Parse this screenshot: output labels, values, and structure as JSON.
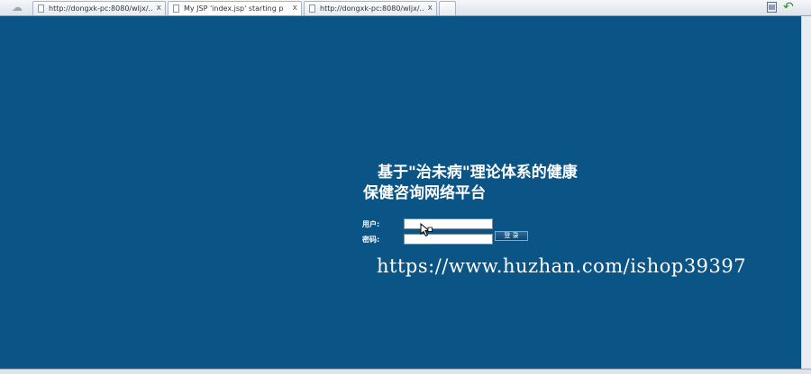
{
  "browser": {
    "tabs": [
      {
        "title": "http://dongxk-pc:8080/wljx/..."
      },
      {
        "title": "My JSP 'index.jsp' starting p"
      },
      {
        "title": "http://dongxk-pc:8080/wljx/..."
      }
    ],
    "close_glyph": "x",
    "home_icon": "home-icon",
    "toolbar_icons": [
      "page-icon",
      "back-arrow-icon"
    ]
  },
  "page": {
    "heading_line1": "基于\"治未病\"理论体系的健康",
    "heading_line2": "保健咨询网络平台",
    "login": {
      "user_label": "用户:",
      "user_value": "",
      "password_label": "密码:",
      "password_value": "",
      "submit_label": "登 录"
    },
    "watermark": "https://www.huzhan.com/ishop39397"
  },
  "colors": {
    "page_background": "#0b5486",
    "text": "#ffffff"
  }
}
